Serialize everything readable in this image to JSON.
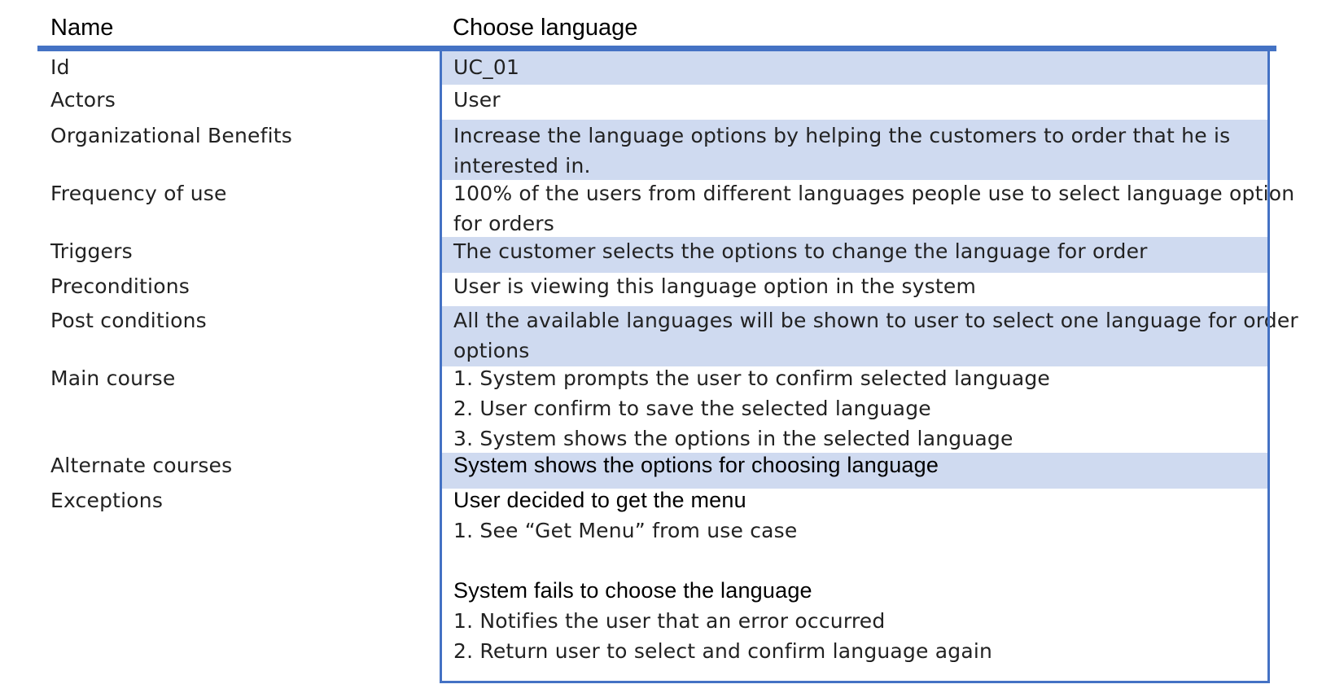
{
  "header": {
    "name_label": "Name",
    "name_value": "Choose language"
  },
  "rows": [
    {
      "label": "Id",
      "lines": [
        "UC_01"
      ],
      "shaded": true
    },
    {
      "label": "Actors",
      "lines": [
        "User"
      ],
      "shaded": false
    },
    {
      "label": "Organizational Benefits",
      "lines": [
        "Increase the language options by helping the customers to order that he is",
        "interested in."
      ],
      "shaded": true
    },
    {
      "label": "Frequency of use",
      "lines": [
        "100% of the users from different languages people use to select language option",
        "for orders"
      ],
      "shaded": false
    },
    {
      "label": "Triggers",
      "lines": [
        "The customer selects the options to change the language for order"
      ],
      "shaded": true
    },
    {
      "label": "Preconditions",
      "lines": [
        "User is viewing this language option in the system"
      ],
      "shaded": false
    },
    {
      "label": "Post conditions",
      "lines": [
        "All the available languages will be shown to user to select one language for order",
        "options"
      ],
      "shaded": true
    },
    {
      "label": "Main course",
      "lines": [
        "1. System prompts the user to confirm selected language",
        "2. User confirm to save the selected language",
        "3. System shows the options in the selected language"
      ],
      "shaded": false
    },
    {
      "label": "Alternate courses",
      "lines": [
        "System shows the options for choosing language"
      ],
      "shaded": true
    },
    {
      "label": "Exceptions",
      "blocks": [
        {
          "heading": "User decided to get the menu",
          "lines": [
            "1. See “Get Menu” from use case"
          ]
        },
        {
          "heading": "System fails to choose the language",
          "lines": [
            "1. Notifies the user that an error occurred",
            "2. Return user to select and confirm language again"
          ]
        }
      ],
      "shaded": false
    }
  ],
  "colors": {
    "accent": "#4472c4",
    "band": "#cfdaf0"
  }
}
